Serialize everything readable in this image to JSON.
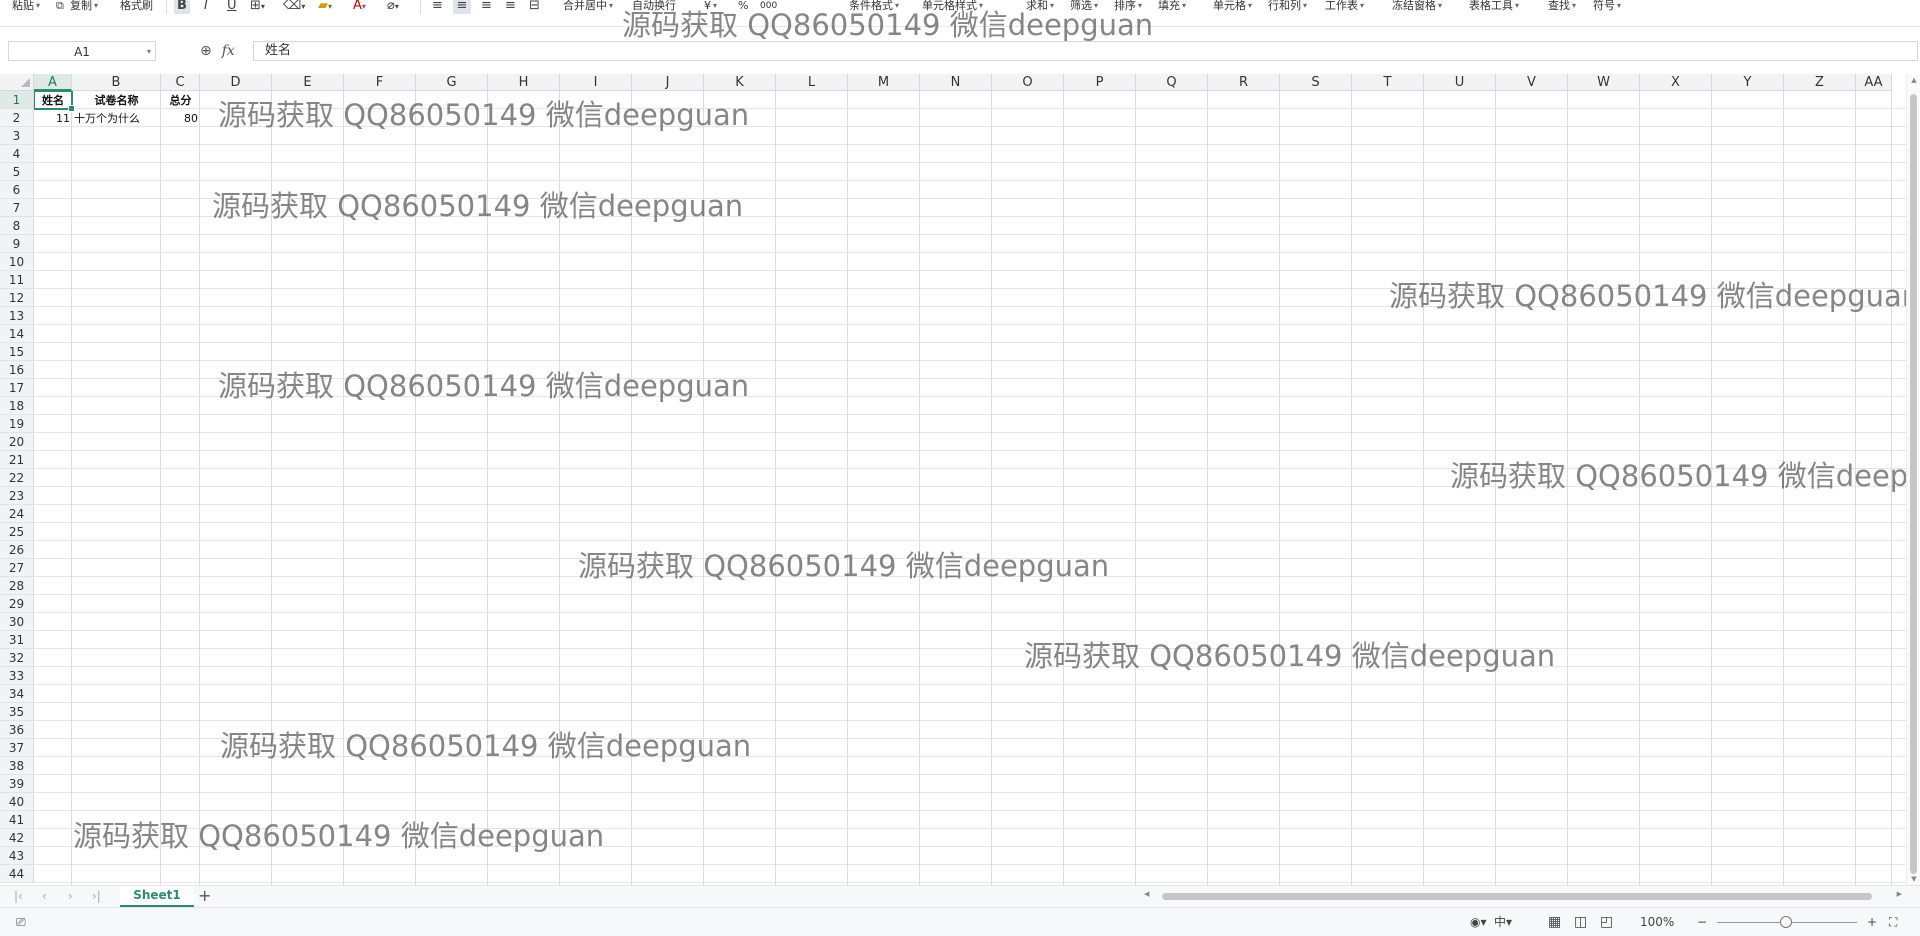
{
  "toolbar": {
    "paste": "粘贴",
    "copy": "复制",
    "format_painter": "格式刷",
    "bold": "B",
    "italic": "I",
    "underline": "U",
    "merge_center": "合并居中",
    "wrap_text": "自动换行",
    "currency": "¥",
    "percent": "%",
    "thousands": "000",
    "conditional_format": "条件格式",
    "cell_style": "单元格样式",
    "sum": "求和",
    "filter": "筛选",
    "sort": "排序",
    "fill": "填充",
    "cell": "单元格",
    "row_col": "行和列",
    "worksheet": "工作表",
    "freeze": "冻结窗格",
    "table_tools": "表格工具",
    "find": "查找",
    "symbol": "符号"
  },
  "formula_bar": {
    "cell_ref": "A1",
    "fx": "fx",
    "content": "姓名"
  },
  "columns": [
    "A",
    "B",
    "C",
    "D",
    "E",
    "F",
    "G",
    "H",
    "I",
    "J",
    "K",
    "L",
    "M",
    "N",
    "O",
    "P",
    "Q",
    "R",
    "S",
    "T",
    "U",
    "V",
    "W",
    "X",
    "Y",
    "Z",
    "AA"
  ],
  "rows": [
    "1",
    "2",
    "3",
    "4",
    "5",
    "6",
    "7",
    "8",
    "9",
    "10",
    "11",
    "12",
    "13",
    "14",
    "15",
    "16",
    "17",
    "18",
    "19",
    "20",
    "21",
    "22",
    "23",
    "24",
    "25",
    "26",
    "27",
    "28",
    "29",
    "30",
    "31",
    "32",
    "33",
    "34",
    "35",
    "36",
    "37",
    "38",
    "39",
    "40",
    "41",
    "42",
    "43",
    "44"
  ],
  "cells": {
    "A1": "姓名",
    "B1": "试卷名称",
    "C1": "总分",
    "A2": "11",
    "B2": "十万个为什么",
    "C2": "80"
  },
  "sheet_tabs": {
    "active": "Sheet1",
    "add": "+"
  },
  "statusbar": {
    "zoom": "100%",
    "zoom_minus": "−",
    "zoom_plus": "+"
  },
  "watermark": "源码获取 QQ86050149 微信deepguan",
  "colors": {
    "accent": "#2e8b6a",
    "grid": "#dadce0",
    "header_bg": "#f2f3f5"
  }
}
